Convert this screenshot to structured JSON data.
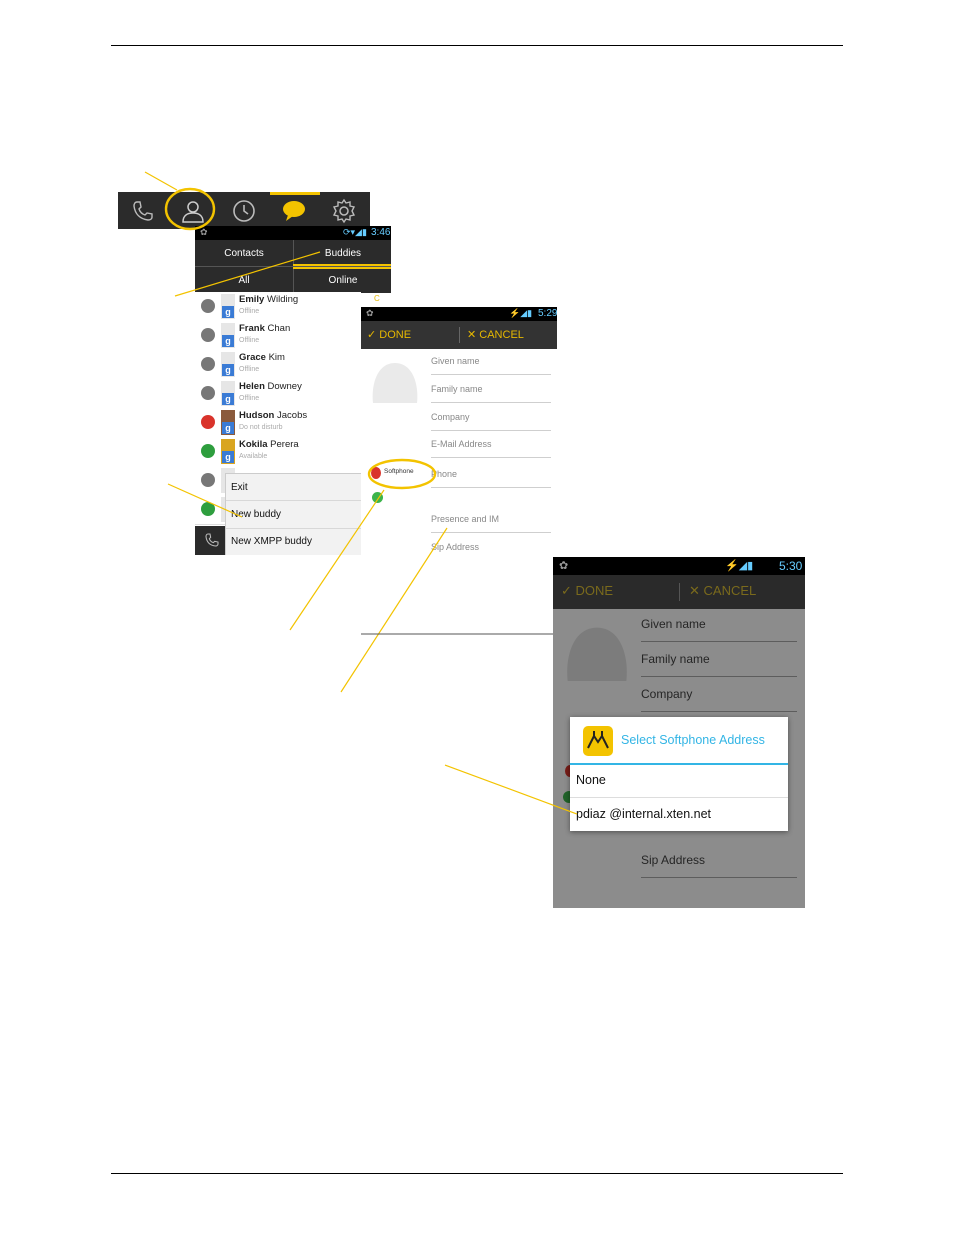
{
  "toolbar": {
    "icons": [
      "phone-icon",
      "contacts-icon",
      "history-icon",
      "messages-icon",
      "settings-icon"
    ]
  },
  "screen1": {
    "status_time": "3:46",
    "tabs": {
      "contacts": "Contacts",
      "buddies": "Buddies",
      "all": "All",
      "online": "Online"
    },
    "stray_char": "C",
    "buddies": [
      {
        "first": "Emily",
        "last": "Wilding",
        "status": "Offline",
        "state": "offline"
      },
      {
        "first": "Frank",
        "last": "Chan",
        "status": "Offline",
        "state": "offline"
      },
      {
        "first": "Grace",
        "last": "Kim",
        "status": "Offline",
        "state": "offline"
      },
      {
        "first": "Helen",
        "last": "Downey",
        "status": "Offline",
        "state": "offline"
      },
      {
        "first": "Hudson",
        "last": "Jacobs",
        "status": "Do not disturb",
        "state": "dnd"
      },
      {
        "first": "Kokila",
        "last": "Perera",
        "status": "Available",
        "state": "available"
      }
    ],
    "menu": [
      "Exit",
      "New buddy",
      "New XMPP buddy"
    ]
  },
  "screen2": {
    "status_time": "5:29",
    "done": "DONE",
    "cancel": "CANCEL",
    "fields": [
      "Given name",
      "Family name",
      "Company",
      "E-Mail Address",
      "Phone",
      "Presence and IM",
      "Sip Address"
    ],
    "softphone_label": "Softphone"
  },
  "screen3": {
    "status_time": "5:30",
    "done": "DONE",
    "cancel": "CANCEL",
    "fields": [
      "Given name",
      "Family name",
      "Company",
      "Sip Address"
    ],
    "dialog": {
      "title": "Select Softphone Address",
      "options": [
        "None",
        "pdiaz @internal.xten.net"
      ]
    }
  },
  "colors": {
    "accent": "#f3c300",
    "bar": "#2b2b2b",
    "dialog_title": "#33b5e5"
  }
}
